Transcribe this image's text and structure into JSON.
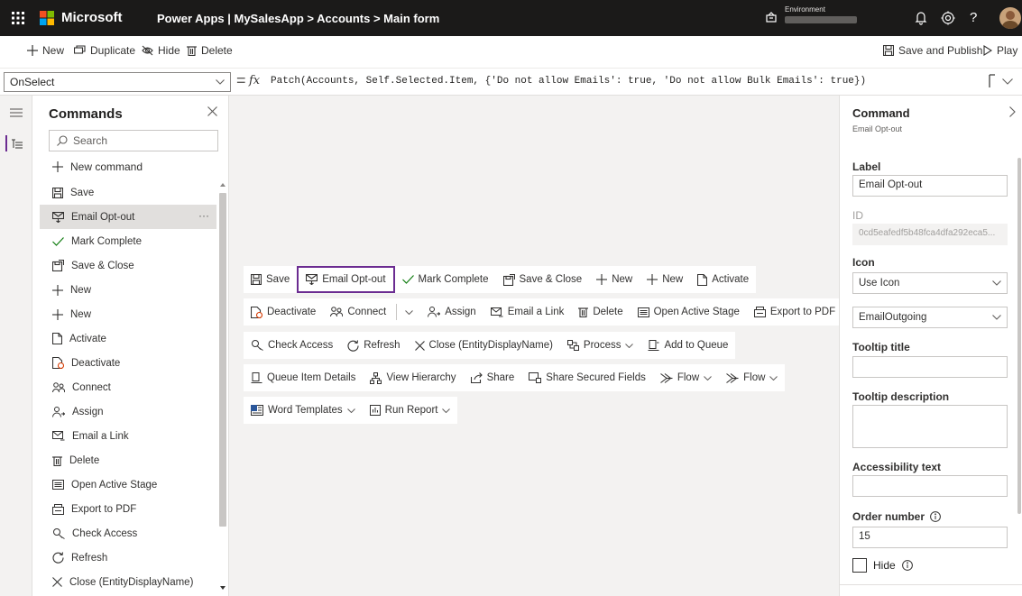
{
  "topbar": {
    "brand": "Microsoft",
    "app_path": "Power Apps | MySalesApp > Accounts > Main form",
    "environment_label": "Environment",
    "help": "?"
  },
  "commandbar": {
    "new": "New",
    "duplicate": "Duplicate",
    "hide": "Hide",
    "delete": "Delete",
    "save_publish": "Save and Publish",
    "play": "Play"
  },
  "formula": {
    "property": "OnSelect",
    "fx": "fx",
    "expression": "Patch(Accounts, Self.Selected.Item, {'Do not allow Emails': true, 'Do not allow Bulk Emails': true})"
  },
  "commands_panel": {
    "title": "Commands",
    "search_placeholder": "Search",
    "new_command": "New command",
    "items": [
      {
        "label": "Save",
        "icon": "save-icon"
      },
      {
        "label": "Email Opt-out",
        "icon": "email-outgoing-icon"
      },
      {
        "label": "Mark Complete",
        "icon": "checkmark-icon"
      },
      {
        "label": "Save & Close",
        "icon": "save-close-icon"
      },
      {
        "label": "New",
        "icon": "plus-icon"
      },
      {
        "label": "New",
        "icon": "plus-icon"
      },
      {
        "label": "Activate",
        "icon": "activate-icon"
      },
      {
        "label": "Deactivate",
        "icon": "deactivate-icon"
      },
      {
        "label": "Connect",
        "icon": "connect-icon"
      },
      {
        "label": "Assign",
        "icon": "assign-icon"
      },
      {
        "label": "Email a Link",
        "icon": "email-link-icon"
      },
      {
        "label": "Delete",
        "icon": "delete-icon"
      },
      {
        "label": "Open Active Stage",
        "icon": "stage-icon"
      },
      {
        "label": "Export to PDF",
        "icon": "pdf-icon"
      },
      {
        "label": "Check Access",
        "icon": "check-access-icon"
      },
      {
        "label": "Refresh",
        "icon": "refresh-icon"
      },
      {
        "label": "Close (EntityDisplayName)",
        "icon": "close-icon"
      }
    ],
    "selected_more": "···"
  },
  "canvas": {
    "row1": [
      "Save",
      "Email Opt-out",
      "Mark Complete",
      "Save & Close",
      "New",
      "New",
      "Activate"
    ],
    "row2": [
      "Deactivate",
      "Connect",
      "Assign",
      "Email a Link",
      "Delete",
      "Open Active Stage",
      "Export to PDF"
    ],
    "row3": [
      "Check Access",
      "Refresh",
      "Close (EntityDisplayName)",
      "Process",
      "Add to Queue"
    ],
    "row4": [
      "Queue Item Details",
      "View Hierarchy",
      "Share",
      "Share Secured Fields",
      "Flow",
      "Flow"
    ],
    "row5": [
      "Word Templates",
      "Run Report"
    ]
  },
  "properties": {
    "title": "Command",
    "subtitle": "Email Opt-out",
    "label_label": "Label",
    "label_value": "Email Opt-out",
    "id_label": "ID",
    "id_value": "0cd5eafedf5b48fca4dfa292eca5...",
    "icon_label": "Icon",
    "icon_mode": "Use Icon",
    "icon_value": "EmailOutgoing",
    "tooltip_title_label": "Tooltip title",
    "tooltip_title_value": "",
    "tooltip_desc_label": "Tooltip description",
    "tooltip_desc_value": "",
    "accessibility_label": "Accessibility text",
    "accessibility_value": "",
    "order_label": "Order number",
    "order_value": "15",
    "hide_label": "Hide"
  },
  "colors": {
    "topbar_bg": "#1b1a19",
    "accent_purple": "#6b2c91",
    "selected_bg": "#e1dfdd",
    "canvas_bg": "#f3f2f1"
  }
}
